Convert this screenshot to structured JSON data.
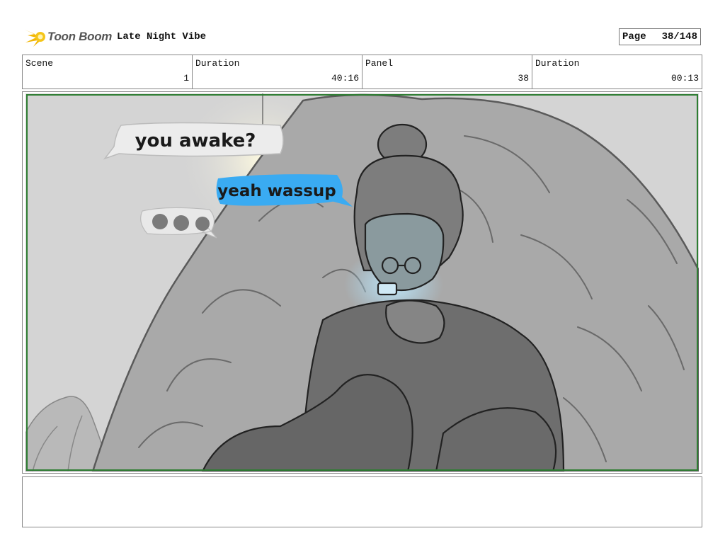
{
  "brand": {
    "name": "Toon Boom",
    "accent": "#f5c518"
  },
  "header": {
    "title": "Late Night Vibe",
    "page_label": "Page",
    "page_value": "38/148"
  },
  "info": {
    "scene_label": "Scene",
    "scene_value": "1",
    "duration_label": "Duration",
    "duration_value": "40:16",
    "panel_label": "Panel",
    "panel_value": "38",
    "panel_duration_label": "Duration",
    "panel_duration_value": "00:13"
  },
  "panel_art": {
    "bubble_1": "you awake?",
    "bubble_2": "yeah wassup",
    "bubble_2_color": "#3aabf2",
    "frame_color": "#2e7d32"
  },
  "notes": {
    "text": ""
  }
}
